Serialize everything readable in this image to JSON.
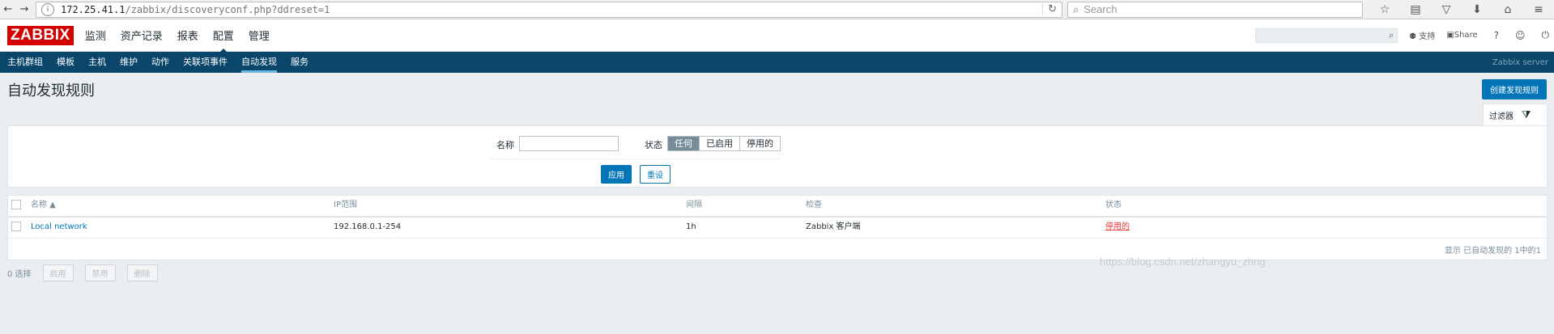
{
  "browser": {
    "url_host": "172.25.41.1",
    "url_path": "/zabbix/discoveryconf.php?ddreset=1",
    "search_placeholder": "Search"
  },
  "app": {
    "logo": "ZABBIX",
    "main_menu": [
      {
        "label": "监测"
      },
      {
        "label": "资产记录"
      },
      {
        "label": "报表"
      },
      {
        "label": "配置"
      },
      {
        "label": "管理"
      }
    ],
    "support_label": "支持",
    "share_label": "Share",
    "help_label": "?",
    "server_name": "Zabbix server"
  },
  "sub_menu": [
    {
      "label": "主机群组"
    },
    {
      "label": "模板"
    },
    {
      "label": "主机"
    },
    {
      "label": "维护"
    },
    {
      "label": "动作"
    },
    {
      "label": "关联项事件"
    },
    {
      "label": "自动发现"
    },
    {
      "label": "服务"
    }
  ],
  "page": {
    "title": "自动发现规则",
    "create_button": "创建发现规则"
  },
  "filter": {
    "tab_label": "过滤器",
    "name_label": "名称",
    "name_value": "",
    "status_label": "状态",
    "status_options": [
      "任何",
      "已启用",
      "停用的"
    ],
    "status_selected": "任何",
    "apply_label": "应用",
    "reset_label": "重设"
  },
  "table": {
    "columns": {
      "name": "名称 ▲",
      "ip_range": "IP范围",
      "interval": "间隔",
      "checks": "检查",
      "status": "状态"
    },
    "rows": [
      {
        "name": "Local network",
        "ip_range": "192.168.0.1-254",
        "interval": "1h",
        "checks": "Zabbix 客户端",
        "status": "停用的"
      }
    ],
    "footer": "显示 已自动发现的 1中的1"
  },
  "bottom": {
    "selected": "0 选择",
    "actions": [
      "启用",
      "禁用",
      "删除"
    ]
  },
  "watermark": "https://blog.csdn.net/zhangyu_zhng"
}
